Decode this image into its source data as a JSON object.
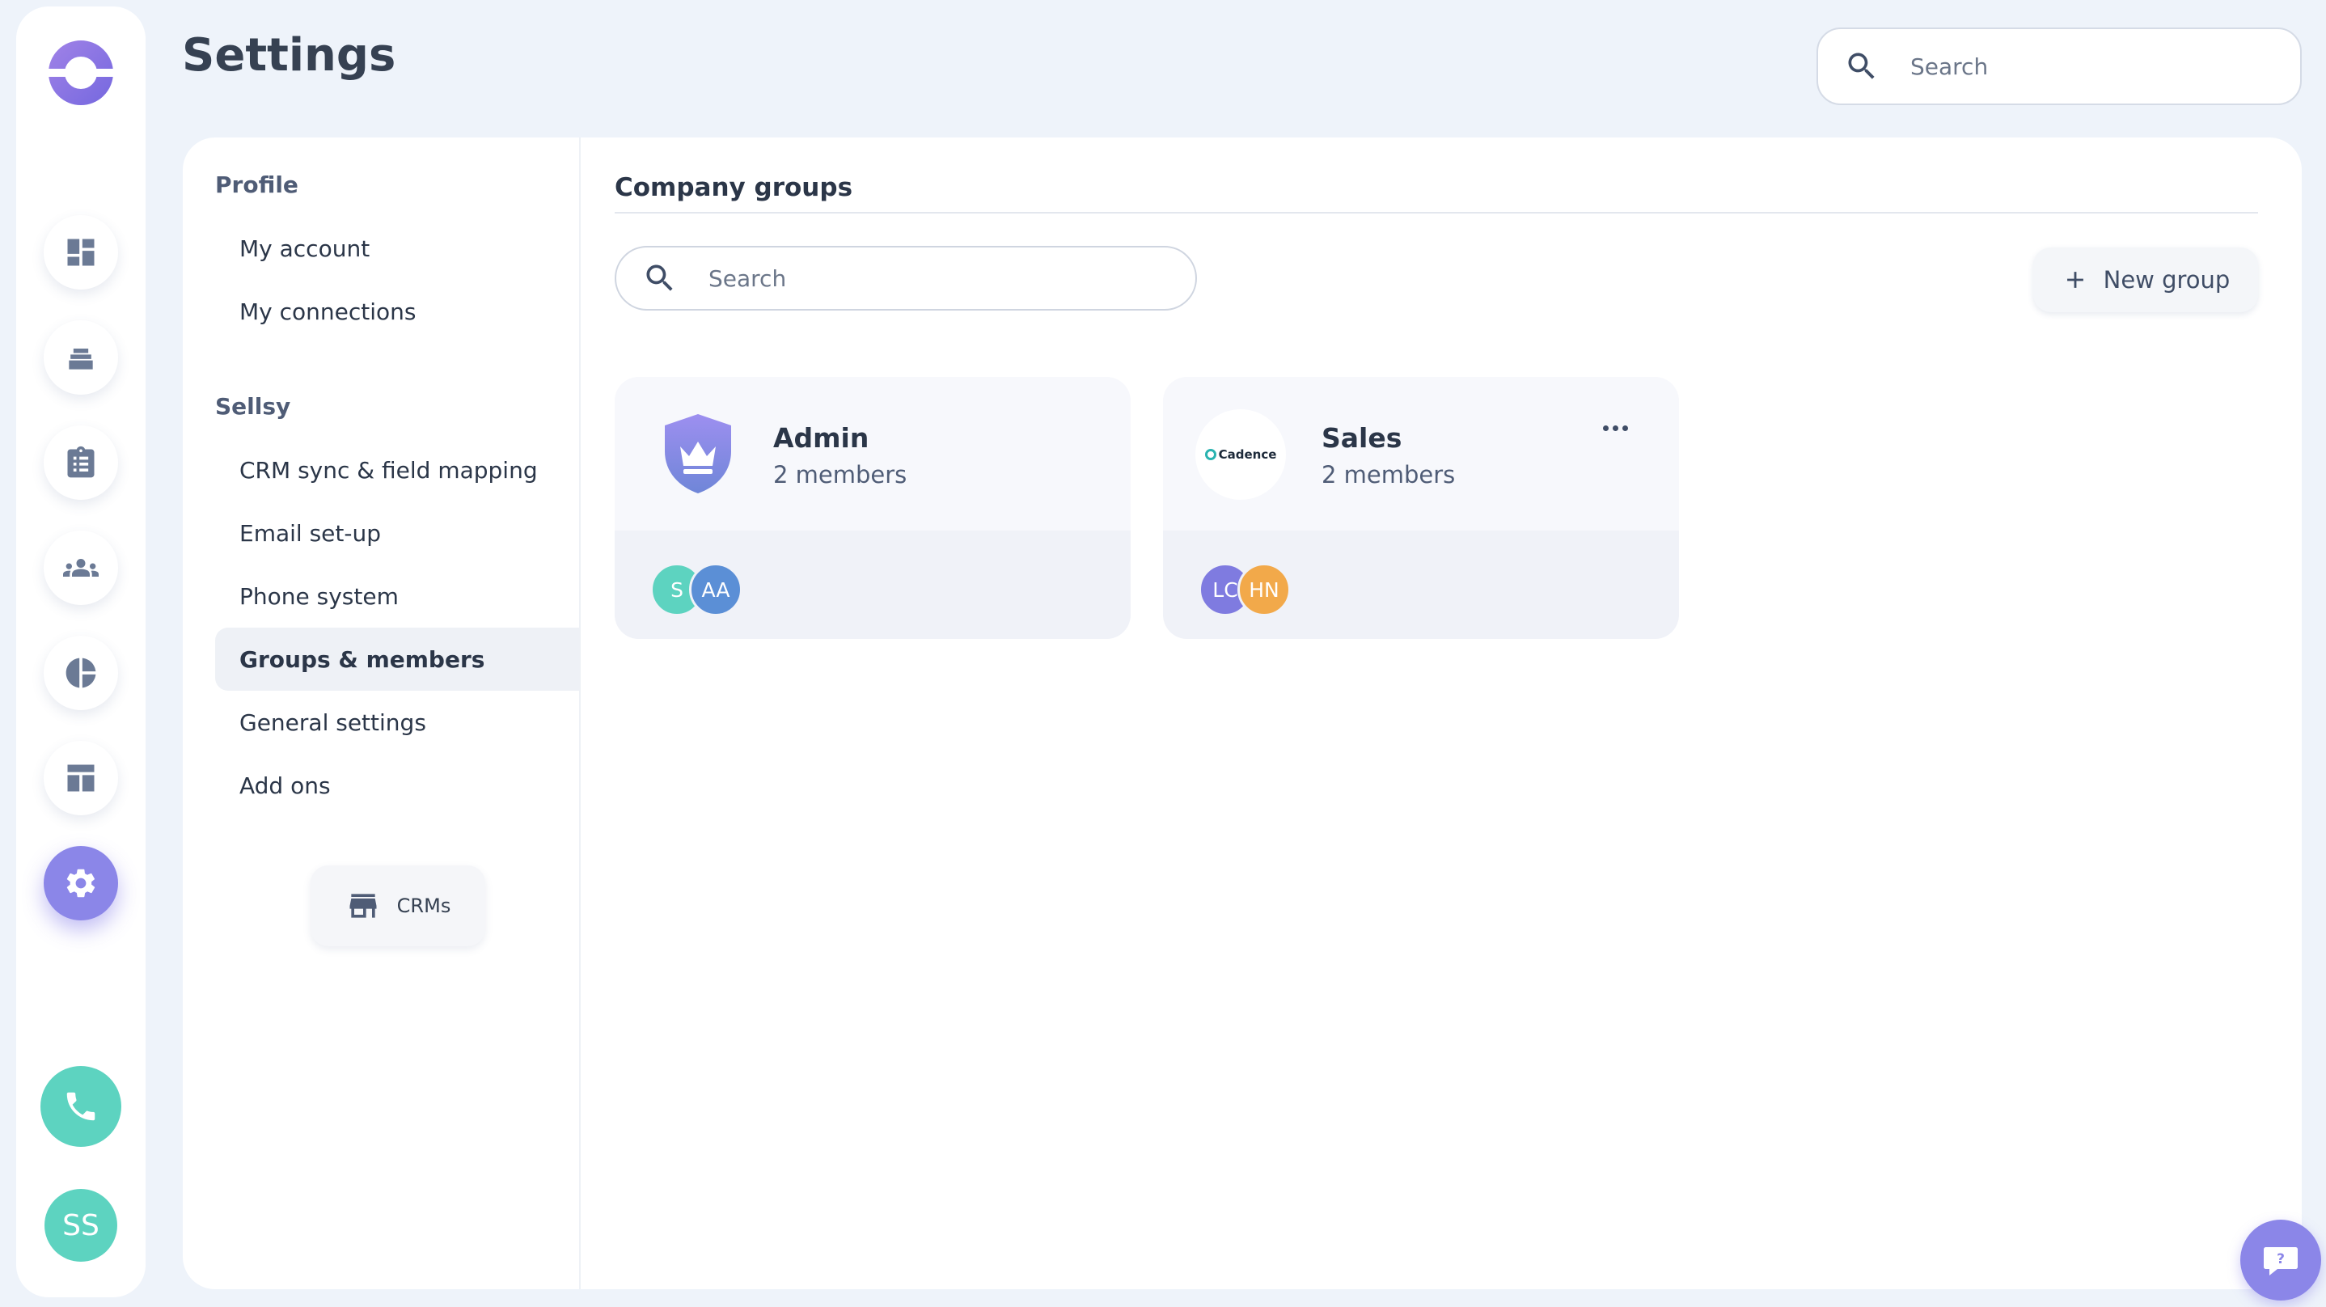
{
  "app": {
    "page_title": "Settings",
    "top_search_placeholder": "Search"
  },
  "rail": {
    "items": [
      {
        "icon": "dashboard-icon"
      },
      {
        "icon": "inbox-stack-icon"
      },
      {
        "icon": "clipboard-list-icon"
      },
      {
        "icon": "people-group-icon"
      },
      {
        "icon": "pie-chart-icon"
      },
      {
        "icon": "layout-template-icon"
      },
      {
        "icon": "gear-icon",
        "active": true
      }
    ],
    "phone_icon": "phone-icon",
    "user_initials": "SS",
    "accent_color": "#8b86e8",
    "teal_color": "#5dd3c0"
  },
  "settings_nav": {
    "profile_heading": "Profile",
    "profile_items": [
      "My account",
      "My connections"
    ],
    "sellsy_heading": "Sellsy",
    "sellsy_items": [
      "CRM sync & field mapping",
      "Email set-up",
      "Phone system",
      "Groups & members",
      "General settings",
      "Add ons"
    ],
    "active_item": "Groups & members",
    "crms_button_label": "CRMs"
  },
  "content": {
    "section_title": "Company groups",
    "search_placeholder": "Search",
    "new_group_label": "New group",
    "groups": [
      {
        "name": "Admin",
        "member_count": "2 members",
        "icon": "crown-shield-icon",
        "avatars": [
          {
            "initials": "S",
            "color": "#5dd3c0"
          },
          {
            "initials": "AA",
            "color": "#5b8fd6"
          }
        ]
      },
      {
        "name": "Sales",
        "member_count": "2 members",
        "logo_text": "Cadence",
        "avatars": [
          {
            "initials": "LC",
            "color": "#7f7be0"
          },
          {
            "initials": "HN",
            "color": "#f2a94a"
          }
        ]
      }
    ]
  },
  "help_icon": "chat-help-icon"
}
